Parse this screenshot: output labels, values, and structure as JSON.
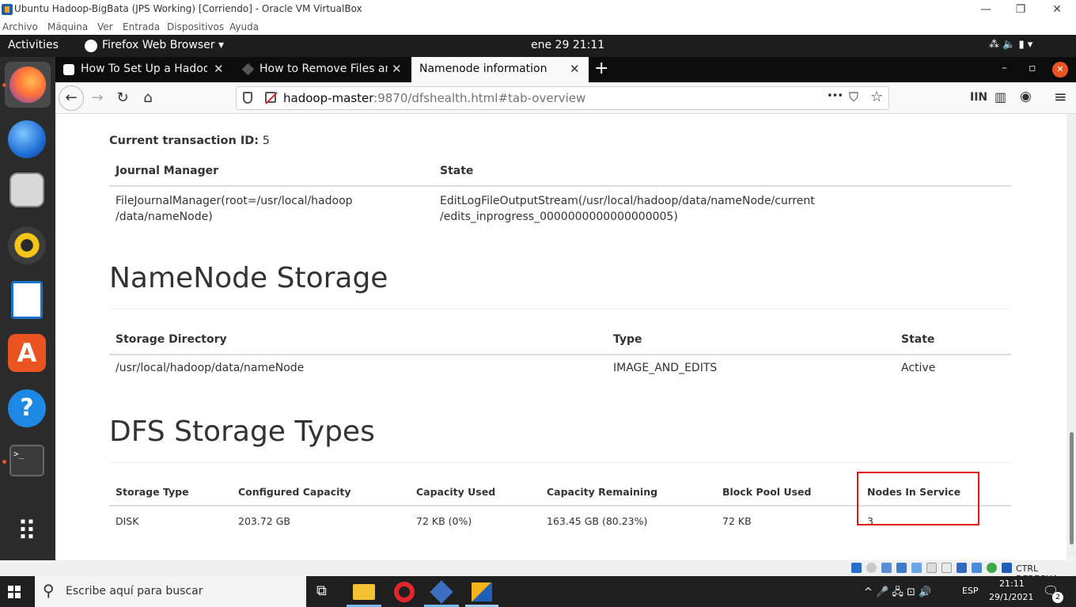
{
  "vbox": {
    "title": "Ubuntu Hadoop-BigBata (JPS Working) [Corriendo] - Oracle VM VirtualBox",
    "menu": [
      "Archivo",
      "Máquina",
      "Ver",
      "Entrada",
      "Dispositivos",
      "Ayuda"
    ],
    "controls": {
      "minimize": "—",
      "restore": "❐",
      "close": "✕"
    },
    "status_host_key": "CTRL DERECHA"
  },
  "ubuntu_topbar": {
    "activities": "Activities",
    "app_menu": "Firefox Web Browser ▾",
    "clock": "ene 29  21:11",
    "sys_icons": "⁂  🔈  ▮  ▾"
  },
  "dock": {
    "apps": [
      "firefox-icon",
      "thunderbird-icon",
      "files-icon",
      "rhythmbox-icon",
      "libreoffice-writer-icon",
      "ubuntu-software-icon",
      "help-icon",
      "terminal-icon"
    ],
    "show_apps_glyph": "⠿"
  },
  "firefox": {
    "tabs": [
      {
        "label": "How To Set Up a Hadoop",
        "close": "✕"
      },
      {
        "label": "How to Remove Files and",
        "close": "✕"
      },
      {
        "label": "Namenode information",
        "close": "✕"
      }
    ],
    "new_tab": "+",
    "window_controls": {
      "minimize": "–",
      "restore": "▫",
      "close": "✕"
    },
    "nav": {
      "back": "←",
      "forward": "→",
      "reload": "↻",
      "home": "⌂"
    },
    "url_host": "hadoop-master",
    "url_rest": ":9870/dfshealth.html#tab-overview",
    "url_actions": {
      "more": "•••",
      "pocket": "⛉",
      "bookmark": "☆"
    },
    "toolbar_right": {
      "library": "IIN",
      "sidebar": "▥",
      "account": "◉",
      "menu": "≡"
    }
  },
  "page": {
    "transaction_label": "Current transaction ID:",
    "transaction_value": "5",
    "journal": {
      "headers": [
        "Journal Manager",
        "State"
      ],
      "row": {
        "manager_line1": "FileJournalManager(root=/usr/local/hadoop",
        "manager_line2": "/data/nameNode)",
        "state_line1": "EditLogFileOutputStream(/usr/local/hadoop/data/nameNode/current",
        "state_line2": "/edits_inprogress_0000000000000000005)"
      }
    },
    "namenode_storage": {
      "title": "NameNode Storage",
      "headers": [
        "Storage Directory",
        "Type",
        "State"
      ],
      "rows": [
        [
          "/usr/local/hadoop/data/nameNode",
          "IMAGE_AND_EDITS",
          "Active"
        ]
      ]
    },
    "dfs_storage_types": {
      "title": "DFS Storage Types",
      "headers": [
        "Storage Type",
        "Configured Capacity",
        "Capacity Used",
        "Capacity Remaining",
        "Block Pool Used",
        "Nodes In Service"
      ],
      "rows": [
        [
          "DISK",
          "203.72 GB",
          "72 KB (0%)",
          "163.45 GB (80.23%)",
          "72 KB",
          "3"
        ]
      ]
    }
  },
  "taskbar": {
    "search_placeholder": "Escribe aquí para buscar",
    "search_glyph": "⚲",
    "taskview_glyph": "⧉",
    "tray_glyphs": "^  🎤  🖧  ⊡  🔊",
    "language": "ESP",
    "time": "21:11",
    "date": "29/1/2021",
    "notification_glyph": "🗨",
    "notification_count": "2"
  },
  "colors": {
    "highlight": "#e01818",
    "ubuntu_orange": "#e95420",
    "taskbar": "#1f1f1f"
  }
}
